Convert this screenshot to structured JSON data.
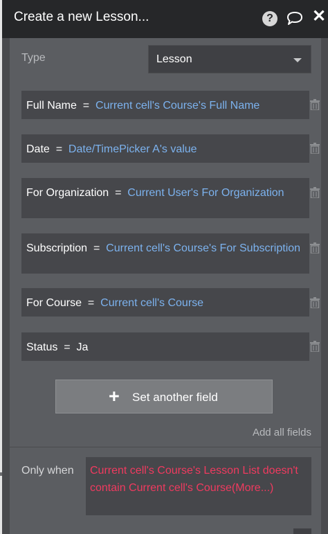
{
  "header": {
    "title": "Create a new Lesson...",
    "icons": [
      "help-icon",
      "comment-icon",
      "close-icon"
    ]
  },
  "type": {
    "label": "Type",
    "value": "Lesson"
  },
  "fields": [
    {
      "key": "Full Name",
      "eq": "=",
      "expr": "Current cell's Course's Full Name"
    },
    {
      "key": "Date",
      "eq": "=",
      "expr": "Date/TimePicker A's value"
    },
    {
      "key": "For Organization",
      "eq": "=",
      "expr": "Current User's For Organization"
    },
    {
      "key": "Subscription",
      "eq": "=",
      "expr": "Current cell's Course's For Subscription"
    },
    {
      "key": "For Course",
      "eq": "=",
      "expr": "Current cell's Course"
    },
    {
      "key": "Status",
      "eq": "=",
      "expr": "Ja"
    }
  ],
  "set_another_field": "Set another field",
  "add_all_fields": "Add all fields",
  "only_when": {
    "label": "Only when",
    "expr": "Current cell's Course's Lesson List doesn't contain Current cell's Course(More...)"
  },
  "colors": {
    "header_bg": "#262729",
    "panel_bg": "#5b5d61",
    "field_bg": "#46474b",
    "expression_blue": "#7cb2ee",
    "condition_red": "#f03a5f"
  }
}
